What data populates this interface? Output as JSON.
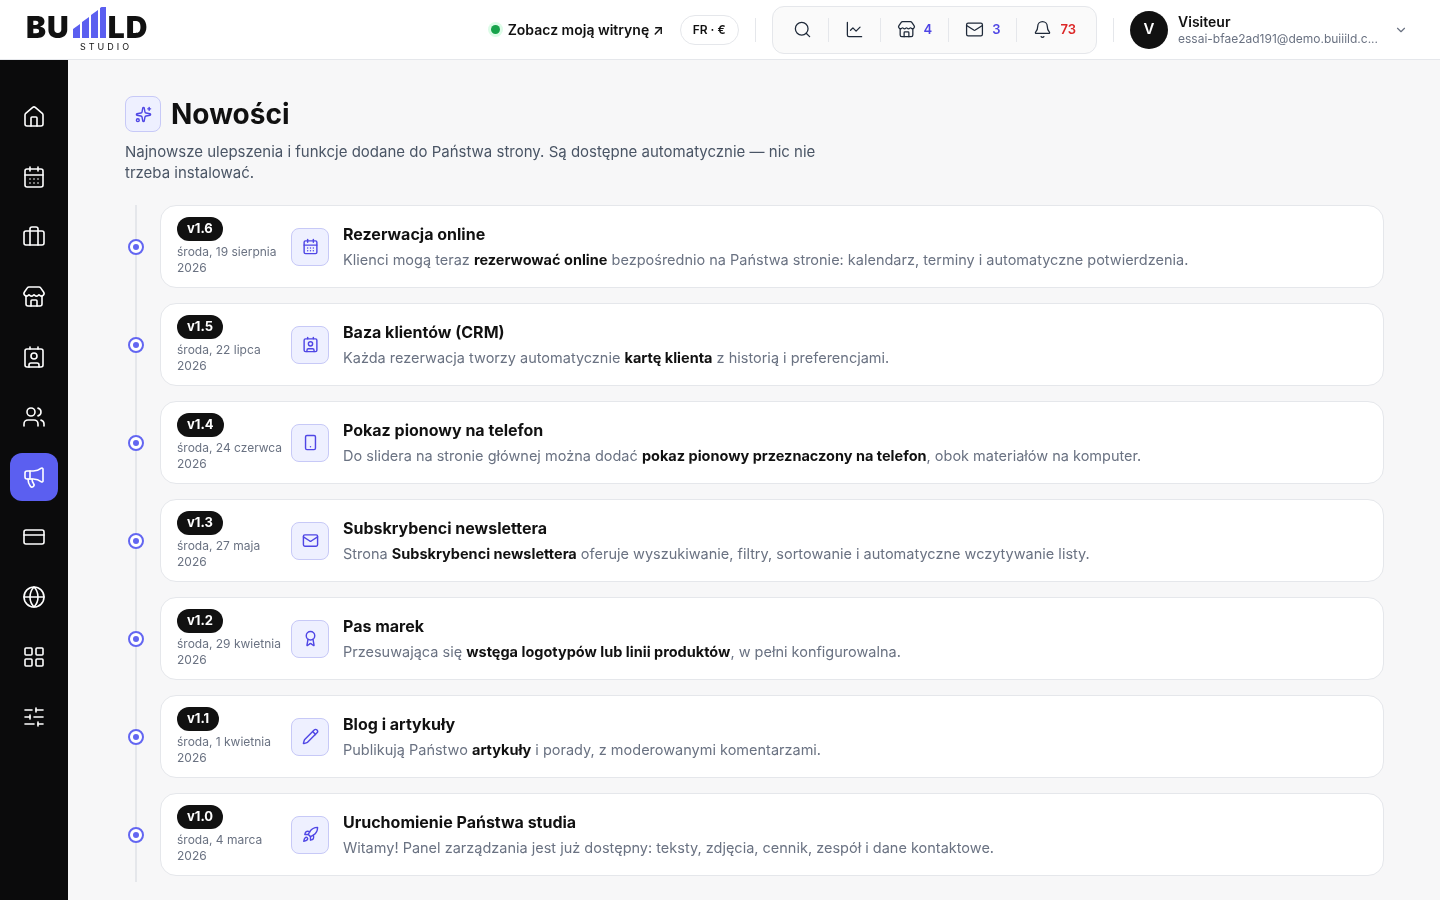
{
  "logo": {
    "left": "BU",
    "right": "LD",
    "tagline": "STUDIO"
  },
  "header": {
    "site_link": "Zobacz moją witrynę ↗",
    "locale": "FR · €",
    "tools": [
      {
        "kind": "search"
      },
      {
        "kind": "stats"
      },
      {
        "kind": "store",
        "count": "4",
        "color": "#4f46e5"
      },
      {
        "kind": "mail",
        "count": "3",
        "color": "#4f46e5"
      },
      {
        "kind": "bell",
        "count": "73",
        "color": "#dc2626"
      }
    ],
    "user": {
      "initial": "V",
      "name": "Visiteur",
      "email": "essai-bfae2ad191@demo.buiiild.c..."
    }
  },
  "sidebar": {
    "items": [
      {
        "selected": false
      },
      {
        "selected": false
      },
      {
        "selected": false
      },
      {
        "selected": false
      },
      {
        "selected": false
      },
      {
        "selected": false
      },
      {
        "selected": true
      },
      {
        "selected": false
      },
      {
        "selected": false
      },
      {
        "selected": false
      },
      {
        "selected": false
      }
    ]
  },
  "page": {
    "title": "Nowości",
    "subtitle": "Najnowsze ulepszenia i funkcje dodane do Państwa strony. Są dostępne automatycznie — nic nie trzeba instalować."
  },
  "releases": [
    {
      "version": "v1.6",
      "date": "środa, 19 sierpnia 2026",
      "title": "Rezerwacja online",
      "text": "Klienci mogą teraz **rezerwować online** bezpośrednio na Państwa stronie: kalendarz, terminy i automatyczne potwierdzenia."
    },
    {
      "version": "v1.5",
      "date": "środa, 22 lipca 2026",
      "title": "Baza klientów (CRM)",
      "text": "Każda rezerwacja tworzy automatycznie **kartę klienta** z historią i preferencjami."
    },
    {
      "version": "v1.4",
      "date": "środa, 24 czerwca 2026",
      "title": "Pokaz pionowy na telefon",
      "text": "Do slidera na stronie głównej można dodać **pokaz pionowy przeznaczony na telefon**, obok materiałów na komputer."
    },
    {
      "version": "v1.3",
      "date": "środa, 27 maja 2026",
      "title": "Subskrybenci newslettera",
      "text": "Strona **Subskrybenci newslettera** oferuje wyszukiwanie, filtry, sortowanie i automatyczne wczytywanie listy."
    },
    {
      "version": "v1.2",
      "date": "środa, 29 kwietnia 2026",
      "title": "Pas marek",
      "text": "Przesuwająca się **wstęga logotypów lub linii produktów**, w pełni konfigurowalna."
    },
    {
      "version": "v1.1",
      "date": "środa, 1 kwietnia 2026",
      "title": "Blog i artykuły",
      "text": "Publikują Państwo **artykuły** i porady, z moderowanymi komentarzami."
    },
    {
      "version": "v1.0",
      "date": "środa, 4 marca 2026",
      "title": "Uruchomienie Państwa studia",
      "text": "Witamy! Panel zarządzania jest już dostępny: teksty, zdjęcia, cennik, zespół i dane kontaktowe."
    }
  ]
}
